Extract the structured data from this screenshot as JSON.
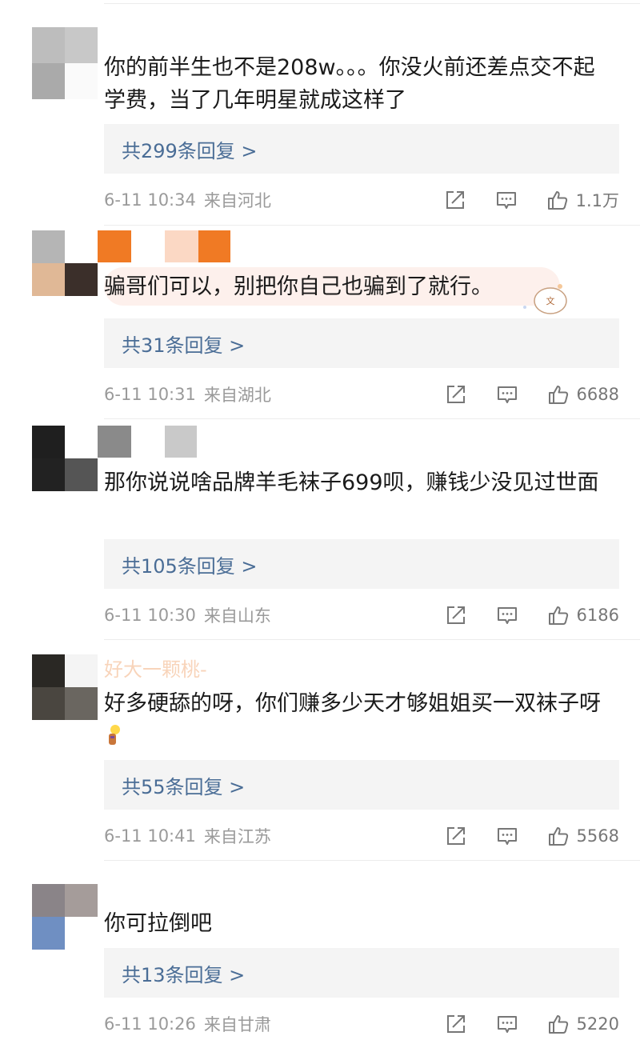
{
  "comments": [
    {
      "text": "你的前半生也不是208w。。。你没火前还差点交不起学费，当了几年明星就成这样了",
      "replies": "共299条回复 >",
      "time": "6-11 10:34",
      "location": "来自河北",
      "likes": "1.1万"
    },
    {
      "text": "骗哥们可以，别把你自己也骗到了就行。",
      "replies": "共31条回复 >",
      "time": "6-11 10:31",
      "location": "来自湖北",
      "likes": "6688"
    },
    {
      "text": "那你说说啥品牌羊毛袜子699呗，赚钱少没见过世面",
      "replies": "共105条回复 >",
      "time": "6-11 10:30",
      "location": "来自山东",
      "likes": "6186"
    },
    {
      "username": "好大一颗桃-",
      "text": "好多硬舔的呀，你们赚多少天才够姐姐买一双袜子呀",
      "replies": "共55条回复 >",
      "time": "6-11 10:41",
      "location": "来自江苏",
      "likes": "5568"
    },
    {
      "text": "你可拉倒吧",
      "replies": "共13条回复 >",
      "time": "6-11 10:26",
      "location": "来自甘肃",
      "likes": "5220"
    }
  ],
  "icons": {
    "share": "share-icon",
    "comment": "comment-icon",
    "like": "thumbs-up-icon"
  },
  "colors": {
    "reply_link": "#4a6d96",
    "meta_text": "#9a9a9a",
    "reply_bg": "#f4f4f4"
  }
}
